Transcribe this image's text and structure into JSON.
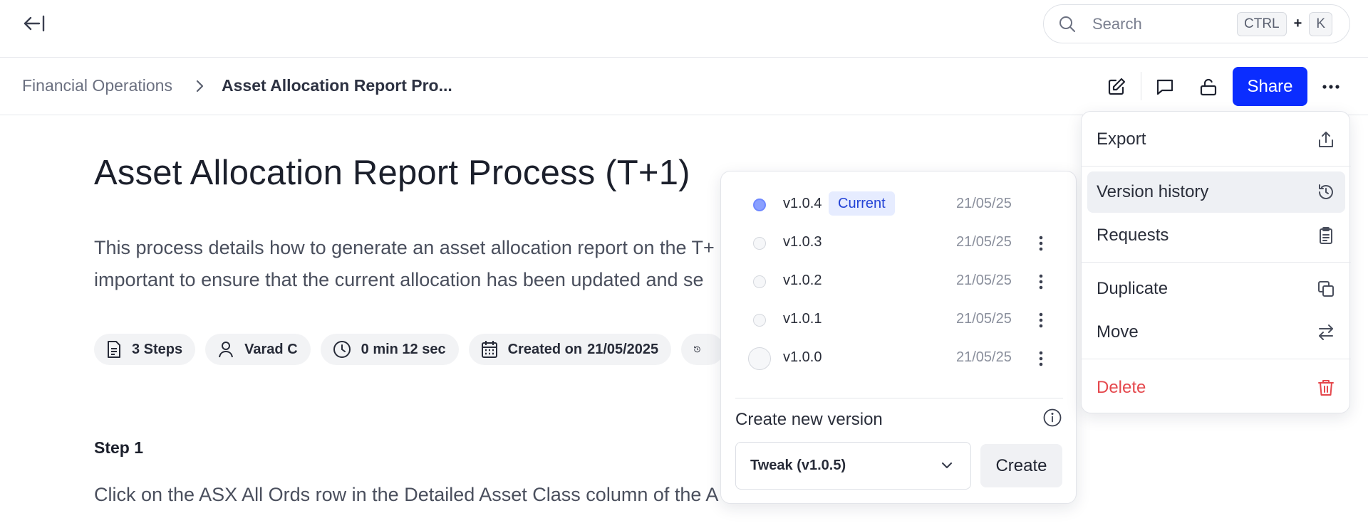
{
  "topbar": {
    "search_placeholder": "Search",
    "shortcut_ctrl": "CTRL",
    "shortcut_plus": "+",
    "shortcut_key": "K"
  },
  "breadcrumb": {
    "parent": "Financial Operations",
    "current": "Asset Allocation Report Pro..."
  },
  "header": {
    "share_label": "Share"
  },
  "document": {
    "title": "Asset Allocation Report Process (T+1)",
    "description_line1": "This process details how to generate an asset allocation report on the T+",
    "description_line2": "important to ensure that the current allocation has been updated and se",
    "chips": {
      "steps": "3 Steps",
      "author": "Varad C",
      "duration": "0 min 12 sec",
      "created_prefix": "Created on",
      "created_date": "21/05/2025"
    },
    "step_label": "Step 1",
    "step_text": "Click on the ASX All Ords row in the Detailed Asset Class column of the A"
  },
  "versions": {
    "items": [
      {
        "name": "v1.0.4",
        "badge": "Current",
        "date": "21/05/25"
      },
      {
        "name": "v1.0.3",
        "date": "21/05/25"
      },
      {
        "name": "v1.0.2",
        "date": "21/05/25"
      },
      {
        "name": "v1.0.1",
        "date": "21/05/25"
      },
      {
        "name": "v1.0.0",
        "date": "21/05/25"
      }
    ],
    "create_label": "Create new version",
    "select_value": "Tweak (v1.0.5)",
    "create_button": "Create"
  },
  "menu": {
    "export": "Export",
    "version_history": "Version history",
    "requests": "Requests",
    "duplicate": "Duplicate",
    "move": "Move",
    "delete": "Delete"
  },
  "colors": {
    "brand": "#0b2dff",
    "danger": "#e5484d",
    "badge_bg": "#e6ecff",
    "badge_text": "#2343d6"
  }
}
